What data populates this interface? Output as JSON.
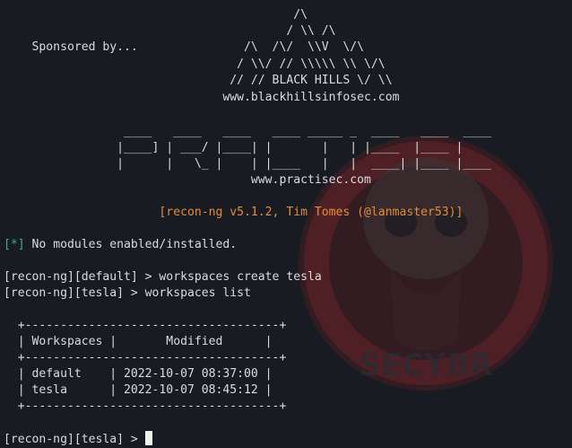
{
  "banner": {
    "sponsor": [
      "                                         /\\",
      "                                        / \\\\ /\\",
      "    Sponsored by...               /\\  /\\/  \\\\V  \\/\\",
      "                                 / \\\\/ // \\\\\\\\\\ \\\\ \\/\\",
      "                                // // BLACK HILLS \\/ \\\\",
      "                               www.blackhillsinfosec.com"
    ],
    "logo": [
      "                 ____   ____   ____   ____ _____ _  ____   ____  ____",
      "                |____] | ___/ |____| |       |   | |____  |____ |",
      "                |      |   \\_ |    | |____   |   |  ____| |____ |____"
    ],
    "website": "                                   www.practisec.com",
    "version": "                      [recon-ng v5.1.2, Tim Tomes (@lanmaster53)]"
  },
  "notice": {
    "marker": "[*]",
    "text": " No modules enabled/installed."
  },
  "history": [
    "[recon-ng][default] > workspaces create tesla",
    "[recon-ng][tesla] > workspaces list"
  ],
  "table": {
    "border": "  +------------------------------------+",
    "header": "  | Workspaces |       Modified      |",
    "rows": [
      "  | default    | 2022-10-07 08:37:00 |",
      "  | tesla      | 2022-10-07 08:45:12 |"
    ]
  },
  "prompt": "[recon-ng][tesla] > ",
  "watermark": {
    "text": "SECYBR",
    "color": "#9e2a2a"
  }
}
